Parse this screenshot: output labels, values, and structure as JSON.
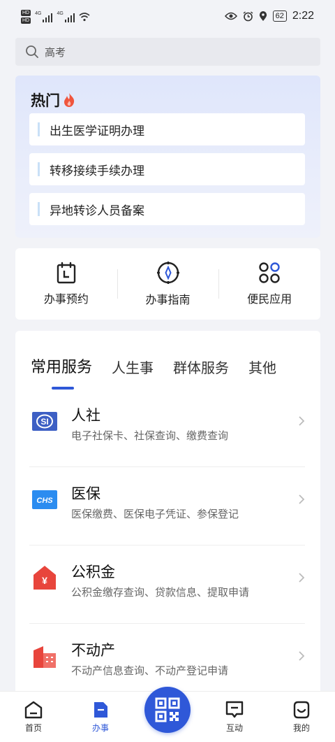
{
  "status_bar": {
    "hd1": "HD",
    "hd2": "HD",
    "net1": "4G",
    "net2": "4G",
    "battery": "62",
    "time": "2:22"
  },
  "search": {
    "placeholder": "高考"
  },
  "hot": {
    "title": "热门",
    "items": [
      "出生医学证明办理",
      "转移接续手续办理",
      "异地转诊人员备案"
    ]
  },
  "quick_actions": [
    {
      "label": "办事预约",
      "icon": "calendar-icon"
    },
    {
      "label": "办事指南",
      "icon": "compass-icon"
    },
    {
      "label": "便民应用",
      "icon": "apps-icon"
    }
  ],
  "tabs": [
    {
      "label": "常用服务",
      "active": true
    },
    {
      "label": "人生事",
      "active": false
    },
    {
      "label": "群体服务",
      "active": false
    },
    {
      "label": "其他",
      "active": false
    }
  ],
  "services": [
    {
      "name": "人社",
      "desc": "电子社保卡、社保查询、缴费查询",
      "icon": "social-security-icon",
      "badge_text": "SI"
    },
    {
      "name": "医保",
      "desc": "医保缴费、医保电子凭证、参保登记",
      "icon": "medical-insurance-icon",
      "badge_text": "CHS"
    },
    {
      "name": "公积金",
      "desc": "公积金缴存查询、贷款信息、提取申请",
      "icon": "housing-fund-icon",
      "badge_text": "¥"
    },
    {
      "name": "不动产",
      "desc": "不动产信息查询、不动产登记申请",
      "icon": "real-estate-icon",
      "badge_text": ""
    }
  ],
  "bottom_nav": [
    {
      "label": "首页",
      "icon": "home-icon",
      "active": false
    },
    {
      "label": "办事",
      "icon": "document-icon",
      "active": true
    },
    {
      "label": "互动",
      "icon": "chat-icon",
      "active": false
    },
    {
      "label": "我的",
      "icon": "profile-icon",
      "active": false
    }
  ],
  "colors": {
    "accent": "#2f58d8",
    "hot_flame": "#f0553d",
    "si_blue": "#3d5fc4",
    "chs_blue": "#2b8cf0",
    "red": "#e8453c"
  }
}
